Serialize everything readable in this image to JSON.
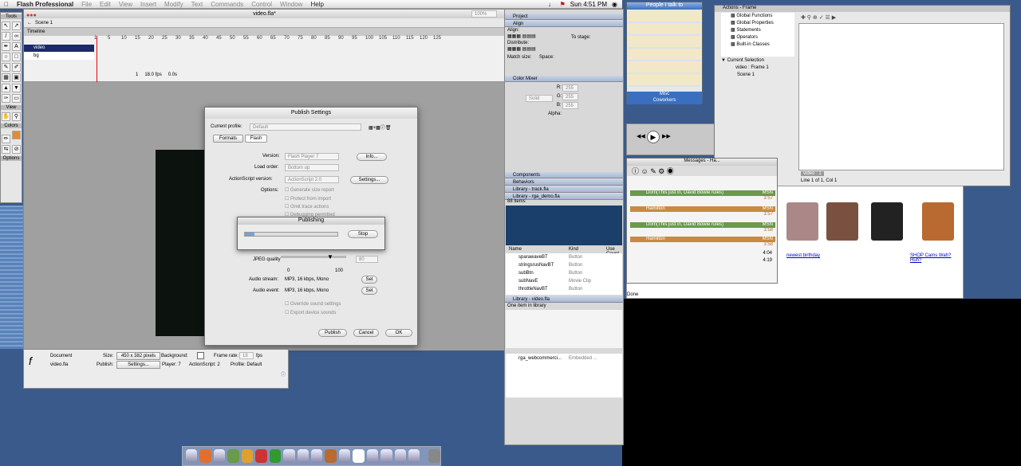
{
  "menubar": {
    "app": "Flash Professional",
    "items": [
      "File",
      "Edit",
      "View",
      "Insert",
      "Modify",
      "Text",
      "Commands",
      "Control",
      "Window",
      "Help"
    ],
    "clock": "Sun 4:51 PM"
  },
  "tools": {
    "title": "Tools",
    "view": "View",
    "colors": "Colors",
    "options": "Options"
  },
  "doc": {
    "title": "video.fla*",
    "scene": "Scene 1",
    "zoom": "100%",
    "timeline": "Timeline",
    "layers": [
      "video",
      "bg"
    ],
    "frames": [
      "1",
      "5",
      "10",
      "15",
      "20",
      "25",
      "30",
      "35",
      "40",
      "45",
      "50",
      "55",
      "60",
      "65",
      "70",
      "75",
      "80",
      "85",
      "90",
      "95",
      "100",
      "105",
      "110",
      "115",
      "120",
      "125"
    ],
    "status": [
      "1",
      "18.0 fps",
      "0.0s"
    ]
  },
  "publish": {
    "title": "Publish Settings",
    "current_profile_label": "Current profile:",
    "current_profile": "Default",
    "tabs": [
      "Formats",
      "Flash"
    ],
    "version_label": "Version:",
    "version": "Flash Player 7",
    "info_btn": "Info...",
    "load_order_label": "Load order:",
    "load_order": "Bottom up",
    "as_label": "ActionScript version:",
    "as_version": "ActionScript 2.0",
    "settings_btn": "Settings...",
    "options_label": "Options:",
    "options": [
      "Generate size report",
      "Protect from import",
      "Omit trace actions",
      "Debugging permitted"
    ],
    "jpeg_label": "JPEG quality",
    "jpeg_value": "80",
    "jpeg_min": "0",
    "jpeg_max": "100",
    "audio_stream_label": "Audio stream:",
    "audio_stream": "MP3, 16 kbps, Mono",
    "audio_event_label": "Audio event:",
    "audio_event": "MP3, 16 kbps, Mono",
    "set_btn": "Set",
    "override": "Override sound settings",
    "export_device": "Export device sounds",
    "publish_btn": "Publish",
    "cancel_btn": "Cancel",
    "ok_btn": "OK"
  },
  "progress": {
    "title": "Publishing",
    "stop": "Stop",
    "level": 0.1
  },
  "props": {
    "document": "Document",
    "file": "video.fla",
    "size_label": "Size:",
    "size": "450 x 382 pixels",
    "bg_label": "Background:",
    "fps_label": "Frame rate:",
    "fps": "18",
    "fps_unit": "fps",
    "publish_label": "Publish:",
    "settings_btn": "Settings...",
    "player": "Player: 7",
    "actionscript": "ActionScript: 2",
    "profile": "Profile: Default"
  },
  "rpanels": {
    "project": "Project",
    "align": "Align",
    "align_label": "Align:",
    "distribute": "Distribute:",
    "match_size": "Match size:",
    "space": "Space:",
    "to_stage": "To stage:",
    "color_mixer": "Color Mixer",
    "fill_type": "Solid",
    "r": "R:",
    "g": "G:",
    "b": "B:",
    "rgb": "255",
    "alpha": "Alpha:",
    "components": "Components",
    "behaviors": "Behaviors",
    "lib_track": "Library - track.fla",
    "lib_rga": "Library - rga_demo.fla",
    "items_count": "88 items",
    "col_name": "Name",
    "col_kind": "Kind",
    "col_use": "Use Count",
    "lib_items": [
      {
        "name": "sparawaveBT",
        "kind": "Button",
        "use": "-"
      },
      {
        "name": "stringsrusNavBT",
        "kind": "Button",
        "use": "-"
      },
      {
        "name": "subBtn",
        "kind": "Button",
        "use": "-"
      },
      {
        "name": "subNavE",
        "kind": "Movie Clip",
        "use": "-"
      },
      {
        "name": "throttleNavBT",
        "kind": "Button",
        "use": "-"
      }
    ],
    "lib_video": "Library - video.fla",
    "one_item": "One item in library",
    "video_item": {
      "name": "rga_webcommerci...",
      "kind": "Embedded ...",
      "use": "-"
    }
  },
  "contacts": {
    "title": "People I talk to",
    "misc": "Misc",
    "coworkers": "Coworkers"
  },
  "actions": {
    "title": "Actions - Frame",
    "tree": [
      "Global Functions",
      "Global Properties",
      "Statements",
      "Operators",
      "Built-in Classes"
    ],
    "current_selection": "Current Selection",
    "video_frame": "video : Frame 1",
    "scene": "Scene 1",
    "tab": "video : 1",
    "status": "Line 1 of 1, Col 1"
  },
  "messages": {
    "title": "Messages - Ha...",
    "rows": [
      {
        "from": "Dorn(This just in, David Bowie rules)",
        "svc": "MSN",
        "time": "3:57"
      },
      {
        "from": "Hamilton",
        "svc": "MSN",
        "time": "3:57"
      },
      {
        "from": "Dorn(This just in, David Bowie rules)",
        "svc": "MSN",
        "time": "3:58"
      },
      {
        "from": "Hamilton",
        "svc": "MSN",
        "time": "3:58"
      }
    ],
    "times": [
      "4:04",
      "4:19"
    ]
  },
  "webpage": {
    "birthday": "newest birthday",
    "links": "SHOP  Cams  Wah?  Huh?",
    "done": "Done"
  }
}
